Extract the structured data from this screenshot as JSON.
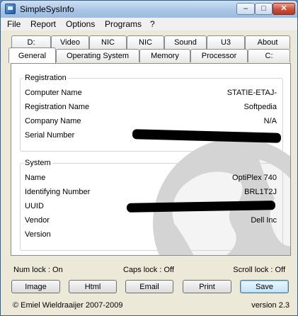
{
  "window": {
    "title": "SimpleSysInfo"
  },
  "menu": [
    "File",
    "Report",
    "Options",
    "Programs",
    "?"
  ],
  "tabs_row1": [
    "D:",
    "Video",
    "NIC",
    "NIC",
    "Sound",
    "U3",
    "About"
  ],
  "tabs_row2": [
    "General",
    "Operating System",
    "Memory",
    "Processor",
    "C:"
  ],
  "active_tab": "General",
  "registration": {
    "title": "Registration",
    "rows": [
      {
        "label": "Computer Name",
        "value": "STATIE-ETAJ-"
      },
      {
        "label": "Registration Name",
        "value": "Softpedia"
      },
      {
        "label": "Company Name",
        "value": "N/A"
      },
      {
        "label": "Serial Number",
        "value": ""
      }
    ]
  },
  "system": {
    "title": "System",
    "rows": [
      {
        "label": "Name",
        "value": "OptiPlex 740"
      },
      {
        "label": "Identifying Number",
        "value": "BRL1T2J"
      },
      {
        "label": "UUID",
        "value": ""
      },
      {
        "label": "Vendor",
        "value": "Dell Inc"
      },
      {
        "label": "Version",
        "value": ""
      }
    ]
  },
  "status": {
    "num_lock": "Num lock : On",
    "caps_lock": "Caps lock : Off",
    "scroll_lock": "Scroll lock : Off"
  },
  "buttons": {
    "image": "Image",
    "html": "Html",
    "email": "Email",
    "print": "Print",
    "save": "Save"
  },
  "footer": {
    "copyright": "© Emiel Wieldraaijer 2007-2009",
    "version": "version 2.3"
  }
}
